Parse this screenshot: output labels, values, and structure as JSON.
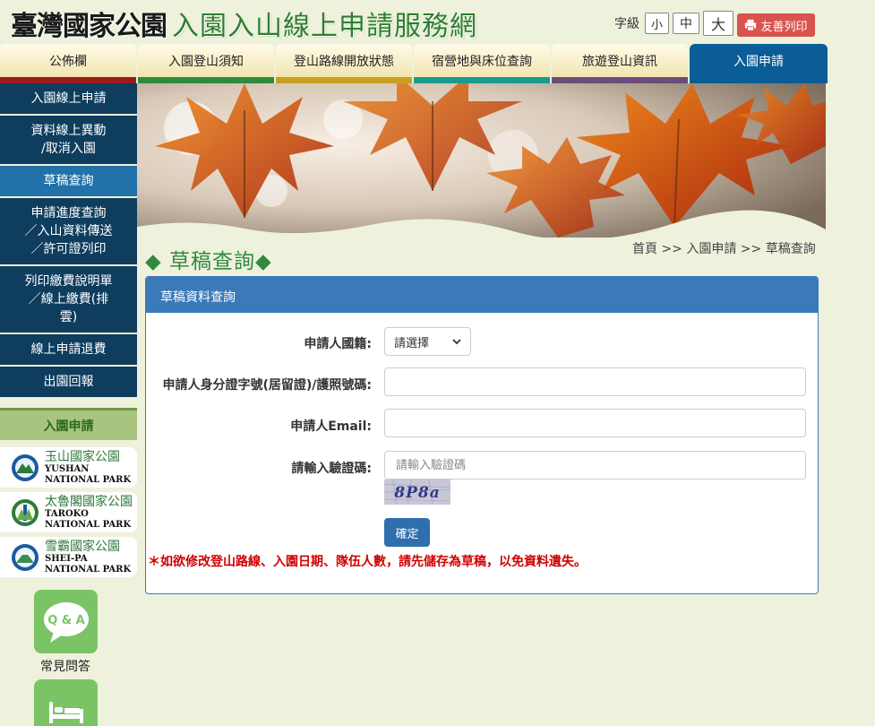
{
  "header": {
    "logo_calligraphy": "臺灣國家公園",
    "logo_title": "入園入山線上申請服務網",
    "font_size_label": "字級",
    "font_sizes": [
      "小",
      "中",
      "大"
    ],
    "print_label": "友善列印"
  },
  "nav": {
    "tabs": [
      {
        "label": "公佈欄",
        "bar": "#9b1b1b"
      },
      {
        "label": "入園登山須知",
        "bar": "#2f8a3e"
      },
      {
        "label": "登山路線開放狀態",
        "bar": "#c8a020"
      },
      {
        "label": "宿營地與床位查詢",
        "bar": "#1d9a8e"
      },
      {
        "label": "旅遊登山資訊",
        "bar": "#6b4c7a"
      },
      {
        "label": "入園申請",
        "bar": "#0a5d96",
        "active": true
      }
    ]
  },
  "sidebar": {
    "items": [
      {
        "label": "入園線上申請"
      },
      {
        "label": "資料線上異動\n/取消入園"
      },
      {
        "label": "草稿查詢",
        "active": true
      },
      {
        "label": "申請進度查詢\n／入山資料傳送\n／許可證列印"
      },
      {
        "label": "列印繳費說明單\n／線上繳費(排\n雲)"
      },
      {
        "label": "線上申請退費"
      },
      {
        "label": "出園回報"
      }
    ],
    "section_title": "入園申請",
    "parks": [
      {
        "zh": "玉山國家公園",
        "en1": "YUSHAN",
        "en2": "NATIONAL PARK"
      },
      {
        "zh": "太魯閣國家公園",
        "en1": "TAROKO",
        "en2": "NATIONAL PARK"
      },
      {
        "zh": "雪霸國家公園",
        "en1": "SHEI-PA",
        "en2": "NATIONAL PARK"
      }
    ],
    "quick_links": [
      {
        "label": "常見問答",
        "icon": "qa-bubble-icon",
        "icon_text": "Q & A"
      },
      {
        "label": "",
        "icon": "bed-icon"
      }
    ]
  },
  "page": {
    "title": "◆ 草稿查詢◆",
    "breadcrumb": "首頁 >> 入園申請 >> 草稿查詢"
  },
  "form": {
    "heading": "草稿資料查詢",
    "nationality_label": "申請人國籍:",
    "nationality_selected": "請選擇",
    "id_label": "申請人身分證字號(居留證)/護照號碼:",
    "id_value": "",
    "email_label": "申請人Email:",
    "email_value": "",
    "captcha_label": "請輸入驗證碼:",
    "captcha_placeholder": "請輸入驗證碼",
    "captcha_text": "8P8a",
    "submit_label": "確定",
    "warning": "＊如欲修改登山路線、入園日期、隊伍人數，請先儲存為草稿，以免資料遺失。"
  },
  "colors": {
    "nav_active": "#0a5d96",
    "sidebar_bg": "#0e3d5e",
    "sidebar_active": "#2271a8",
    "card_header": "#3a7ab8",
    "print_button": "#d9534f",
    "warning": "#d10000"
  }
}
